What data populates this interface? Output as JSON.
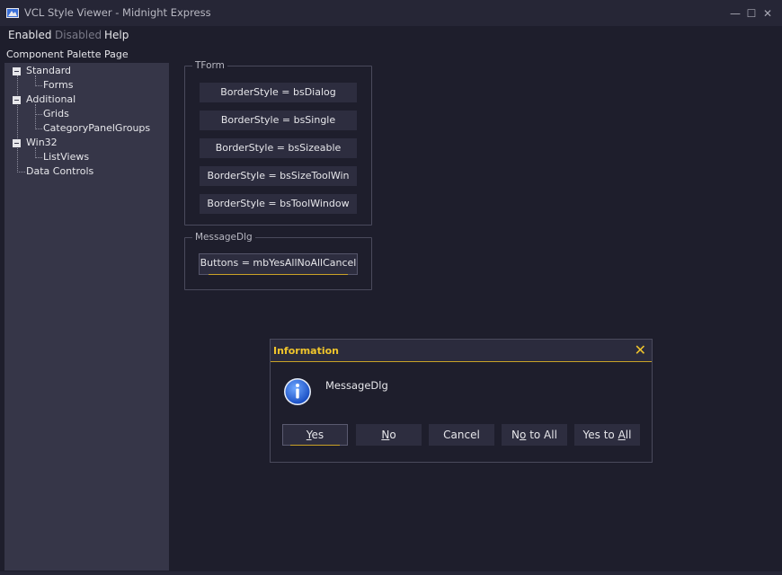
{
  "window": {
    "title": "VCL Style Viewer - Midnight Express",
    "controls": {
      "minimize": "—",
      "maximize": "☐",
      "close": "✕"
    },
    "icons": {
      "app": "vcl-style-app-icon"
    }
  },
  "menu": {
    "items": [
      {
        "label": "Enabled",
        "enabled": true
      },
      {
        "label": "Disabled",
        "enabled": false
      },
      {
        "label": "Help",
        "enabled": true
      }
    ]
  },
  "sidebar": {
    "heading": "Component Palette Page",
    "tree": [
      {
        "label": "Standard",
        "expanded": true,
        "children": [
          "Forms"
        ]
      },
      {
        "label": "Additional",
        "expanded": true,
        "children": [
          "Grids",
          "CategoryPanelGroups"
        ]
      },
      {
        "label": "Win32",
        "expanded": true,
        "children": [
          "ListViews"
        ]
      },
      {
        "label": "Data Controls",
        "expanded": false,
        "children": []
      }
    ]
  },
  "main": {
    "tform": {
      "caption": "TForm",
      "buttons": [
        "BorderStyle = bsDialog",
        "BorderStyle = bsSingle",
        "BorderStyle = bsSizeable",
        "BorderStyle = bsSizeToolWin",
        "BorderStyle = bsToolWindow"
      ]
    },
    "messagedlg": {
      "caption": "MessageDlg",
      "button": "Buttons = mbYesAllNoAllCancel"
    }
  },
  "dialog": {
    "title": "Information",
    "message": "MessageDlg",
    "icon": "information-icon",
    "buttons": [
      {
        "pre": "",
        "accel": "Y",
        "post": "es",
        "default": true
      },
      {
        "pre": "",
        "accel": "N",
        "post": "o",
        "default": false
      },
      {
        "pre": "Cancel",
        "accel": "",
        "post": "",
        "default": false
      },
      {
        "pre": "N",
        "accel": "o",
        "post": " to All",
        "default": false
      },
      {
        "pre": "Yes to ",
        "accel": "A",
        "post": "ll",
        "default": false
      }
    ]
  },
  "colors": {
    "background": "#1e1e2c",
    "panel": "#363648",
    "button": "#2d2d3f",
    "accent": "#f0c52c",
    "text": "#e6e6ea",
    "disabled_text": "#7a7a88"
  }
}
